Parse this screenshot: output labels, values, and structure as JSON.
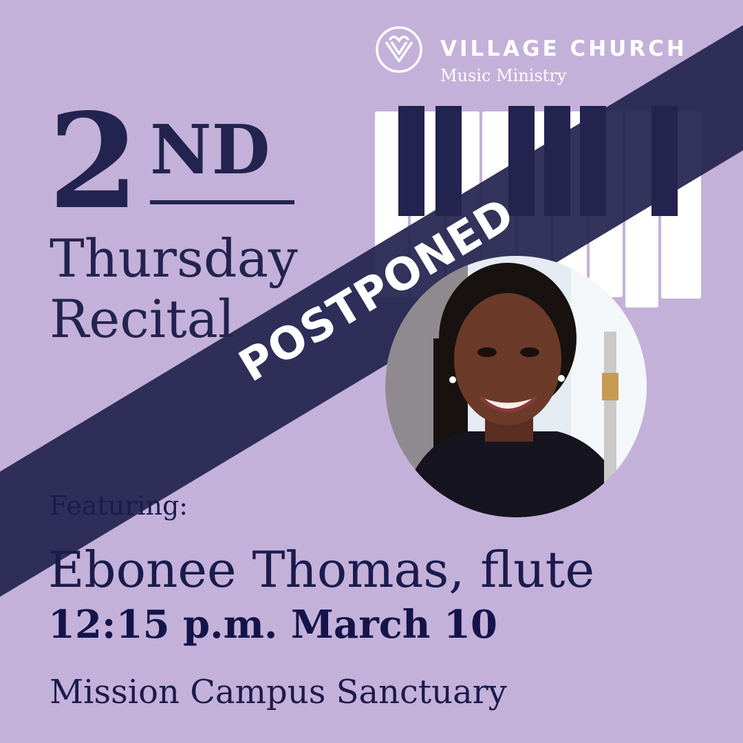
{
  "brand": {
    "name": "VILLAGE CHURCH",
    "subtitle": "Music Ministry",
    "logo_icon": "heart-v-circle-logo"
  },
  "title": {
    "number": "2",
    "suffix": "ND",
    "line1": "Thursday",
    "line2": "Recital"
  },
  "banner": {
    "label": "POSTPONED"
  },
  "event": {
    "featuring_label": "Featuring:",
    "performer": "Ebonee Thomas, flute",
    "datetime": "12:15 p.m. March 10",
    "venue": "Mission Campus Sanctuary"
  },
  "colors": {
    "background": "#c4b1d9",
    "navy": "#23234f",
    "white": "#ffffff"
  },
  "icons": {
    "piano": "piano-keys-icon",
    "portrait": "performer-photo"
  }
}
